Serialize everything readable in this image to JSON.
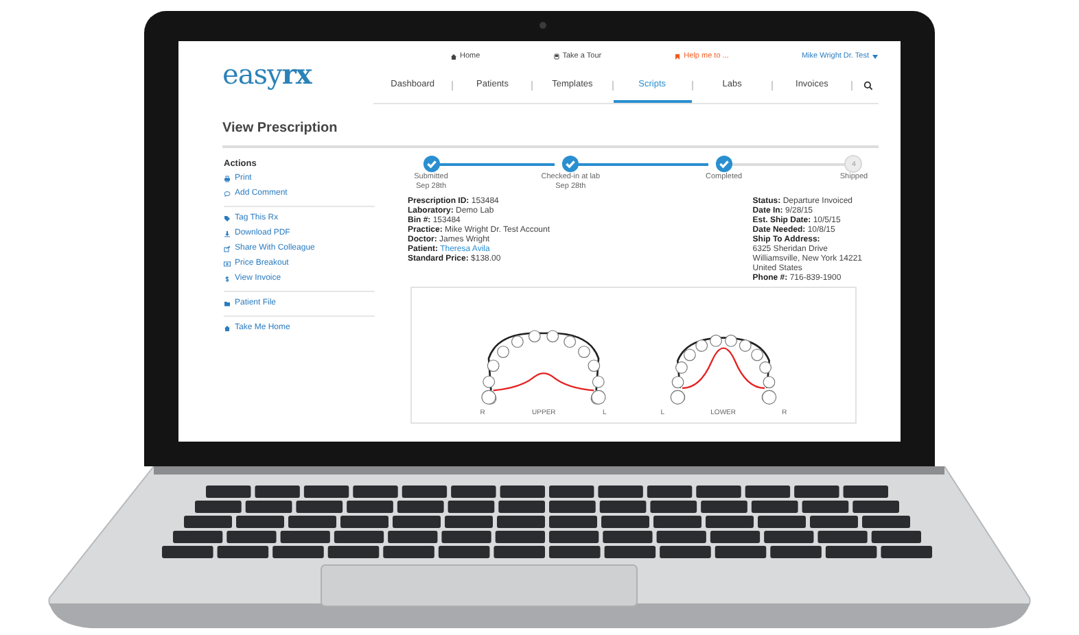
{
  "top_links": [
    {
      "kind": "home",
      "label": "Home"
    },
    {
      "kind": "tour",
      "label": "Take a Tour"
    },
    {
      "kind": "help",
      "label": "Help me to ..."
    },
    {
      "kind": "user",
      "label": "Mike Wright Dr. Test"
    }
  ],
  "logo": "easy**rx**",
  "nav": [
    {
      "label": "Dashboard",
      "selected": false
    },
    {
      "label": "Patients",
      "selected": false
    },
    {
      "label": "Templates",
      "selected": false
    },
    {
      "label": "Scripts",
      "selected": true
    },
    {
      "label": "Labs",
      "selected": false
    },
    {
      "label": "Invoices",
      "selected": false
    }
  ],
  "page_title": "View Prescription",
  "actions": {
    "title": "Actions",
    "groups": [
      [
        {
          "kind": "print",
          "label": "Print"
        },
        {
          "kind": "comment",
          "label": "Add Comment"
        }
      ],
      [
        {
          "kind": "tag",
          "label": "Tag This Rx"
        },
        {
          "kind": "download",
          "label": "Download PDF"
        },
        {
          "kind": "share",
          "label": "Share With Colleague"
        },
        {
          "kind": "price",
          "label": "Price Breakout"
        },
        {
          "kind": "dollar",
          "label": "View Invoice"
        }
      ],
      [
        {
          "kind": "folder",
          "label": "Patient File"
        }
      ],
      [
        {
          "kind": "home",
          "label": "Take Me Home"
        }
      ]
    ]
  },
  "steps": [
    {
      "label": "Submitted",
      "date": "Sep 28th",
      "done": true
    },
    {
      "label": "Checked-in at lab",
      "date": "Sep 28th",
      "done": true
    },
    {
      "label": "Completed",
      "done": true
    },
    {
      "label": "Shipped",
      "number": "4",
      "done": false
    }
  ],
  "details_left": [
    {
      "label": "Prescription ID:",
      "value": "153484",
      "link": false
    },
    {
      "label": "Laboratory:",
      "value": "Demo Lab",
      "link": false
    },
    {
      "label": "Bin #:",
      "value": "153484",
      "link": false
    },
    {
      "label": "Practice:",
      "value": "Mike Wright Dr. Test Account",
      "link": false
    },
    {
      "label": "Doctor:",
      "value": "James Wright",
      "link": false
    },
    {
      "label": "Patient:",
      "value": "Theresa Avila",
      "link": true
    },
    {
      "label": "Standard Price:",
      "value": "$138.00",
      "link": false
    }
  ],
  "details_right": [
    {
      "label": "Status:",
      "value": "Departure Invoiced"
    },
    {
      "label": "Date In:",
      "value": "9/28/15"
    },
    {
      "label": "Est. Ship Date:",
      "value": "10/5/15"
    },
    {
      "label": "Date Needed:",
      "value": "10/8/15"
    },
    {
      "label": "Ship To Address:",
      "lines": [
        "6325 Sheridan Drive",
        "Williamsville, New York 14221",
        "United States"
      ]
    },
    {
      "label": "Phone #:",
      "value": "716-839-1900"
    }
  ],
  "arches": [
    {
      "kind": "upper",
      "labels": [
        "R",
        "UPPER",
        "L"
      ]
    },
    {
      "kind": "lower",
      "labels": [
        "L",
        "LOWER",
        "R"
      ]
    }
  ]
}
